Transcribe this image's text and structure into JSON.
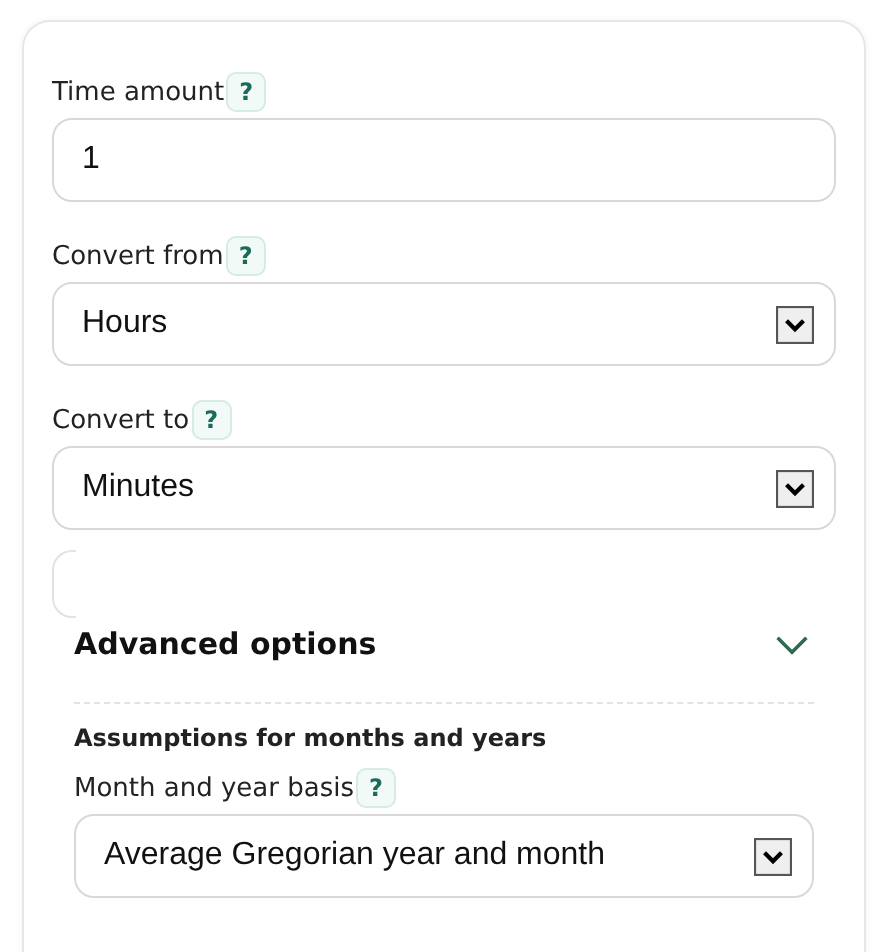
{
  "fields": [
    {
      "kind": "input",
      "label": "Time amount",
      "help": "?",
      "value": "1"
    },
    {
      "kind": "select",
      "label": "Convert from",
      "help": "?",
      "value": "Hours"
    },
    {
      "kind": "select",
      "label": "Convert to",
      "help": "?",
      "value": "Minutes"
    }
  ],
  "advanced": {
    "title": "Advanced options",
    "expanded": true,
    "subheading": "Assumptions for months and years",
    "fields": [
      {
        "kind": "select",
        "label": "Month and year basis",
        "help": "?",
        "value": "Average Gregorian year and month"
      }
    ]
  }
}
